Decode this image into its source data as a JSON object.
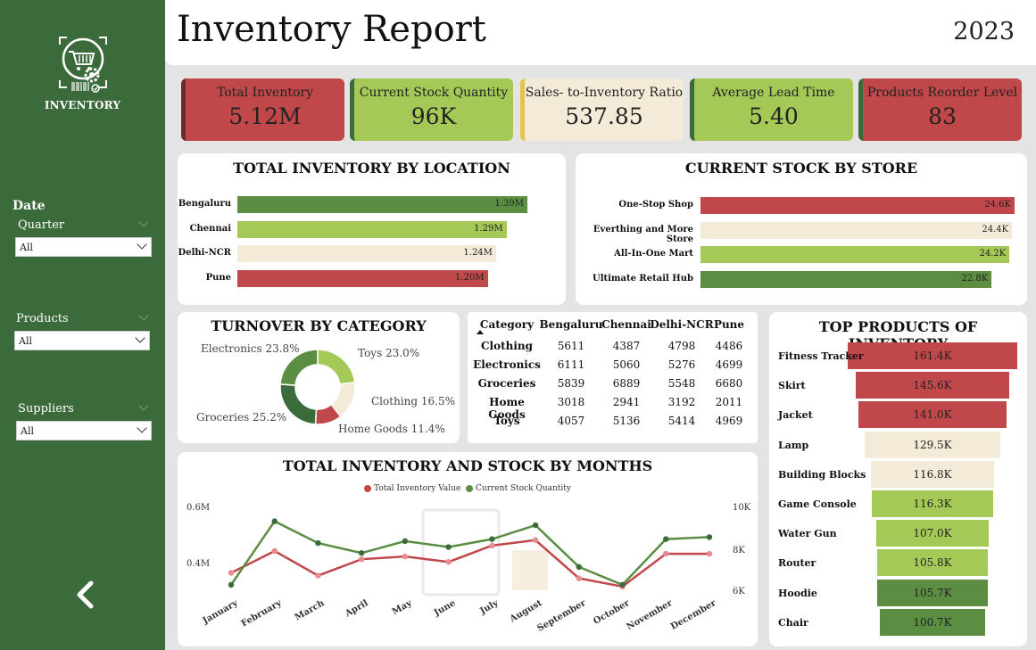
{
  "sidebar": {
    "logo_text": "INVENTORY",
    "date_label": "Date",
    "quarter_label": "Quarter",
    "quarter_value": "All",
    "products_label": "Products",
    "products_value": "All",
    "suppliers_label": "Suppliers",
    "suppliers_value": "All",
    "back_icon": "chevron-left-icon"
  },
  "header": {
    "title": "Inventory Report",
    "year": "2023"
  },
  "kpis": [
    {
      "label": "Total Inventory",
      "value": "5.12M",
      "color": "#c0474a"
    },
    {
      "label": "Current Stock Quantity",
      "value": "96K",
      "color": "#a4c957"
    },
    {
      "label": "Sales- to-Inventory Ratio",
      "value": "537.85",
      "color": "#f3ead8"
    },
    {
      "label": "Average Lead Time",
      "value": "5.40",
      "color": "#a4c957"
    },
    {
      "label": "Products Reorder Level",
      "value": "83",
      "color": "#c0474a"
    }
  ],
  "location_chart": {
    "title": "TOTAL INVENTORY BY LOCATION",
    "rows": [
      {
        "label": "Bengaluru",
        "value": 1.39,
        "display": "1.39M",
        "color": "#5b8e42"
      },
      {
        "label": "Chennai",
        "value": 1.29,
        "display": "1.29M",
        "color": "#a4c957"
      },
      {
        "label": "Delhi-NCR",
        "value": 1.24,
        "display": "1.24M",
        "color": "#f3ead8"
      },
      {
        "label": "Pune",
        "value": 1.2,
        "display": "1.20M",
        "color": "#c0474a"
      }
    ]
  },
  "store_chart": {
    "title": "CURRENT STOCK BY STORE",
    "rows": [
      {
        "label": "One-Stop Shop",
        "value": 24.6,
        "display": "24.6K",
        "color": "#c0474a"
      },
      {
        "label": "Everthing and More Store",
        "value": 24.4,
        "display": "24.4K",
        "color": "#f3ead8"
      },
      {
        "label": "All-In-One Mart",
        "value": 24.2,
        "display": "24.2K",
        "color": "#a4c957"
      },
      {
        "label": "Ultimate Retail Hub",
        "value": 22.8,
        "display": "22.8K",
        "color": "#5b8e42"
      }
    ]
  },
  "turnover": {
    "title": "TURNOVER BY CATEGORY",
    "labels": [
      {
        "text": "Electronics 23.8%"
      },
      {
        "text": "Toys 23.0%"
      },
      {
        "text": "Clothing 16.5%"
      },
      {
        "text": "Home Goods 11.4%"
      },
      {
        "text": "Groceries 25.2%"
      }
    ]
  },
  "table": {
    "headers": [
      "Category",
      "Bengaluru",
      "Chennai",
      "Delhi-NCR",
      "Pune"
    ],
    "sort_icon": "sort-up-icon",
    "rows": [
      [
        "Clothing",
        "5611",
        "4387",
        "4798",
        "4486"
      ],
      [
        "Electronics",
        "6111",
        "5060",
        "5276",
        "4699"
      ],
      [
        "Groceries",
        "5839",
        "6889",
        "5548",
        "6680"
      ],
      [
        "Home Goods",
        "3018",
        "2941",
        "3192",
        "2011"
      ],
      [
        "Toys",
        "4057",
        "5136",
        "5414",
        "4969"
      ]
    ]
  },
  "top_products": {
    "title": "TOP PRODUCTS OF INVENTORY",
    "rows": [
      {
        "label": "Fitness Tracker",
        "value": 161.4,
        "display": "161.4K",
        "color": "#c0474a"
      },
      {
        "label": "Skirt",
        "value": 145.6,
        "display": "145.6K",
        "color": "#c0474a"
      },
      {
        "label": "Jacket",
        "value": 141.0,
        "display": "141.0K",
        "color": "#c0474a"
      },
      {
        "label": "Lamp",
        "value": 129.5,
        "display": "129.5K",
        "color": "#f3ead8"
      },
      {
        "label": "Building Blocks",
        "value": 116.8,
        "display": "116.8K",
        "color": "#f3ead8"
      },
      {
        "label": "Game Console",
        "value": 116.3,
        "display": "116.3K",
        "color": "#a4c957"
      },
      {
        "label": "Water Gun",
        "value": 107.0,
        "display": "107.0K",
        "color": "#a4c957"
      },
      {
        "label": "Router",
        "value": 105.8,
        "display": "105.8K",
        "color": "#a4c957"
      },
      {
        "label": "Hoodie",
        "value": 105.7,
        "display": "105.7K",
        "color": "#5b8e42"
      },
      {
        "label": "Chair",
        "value": 100.7,
        "display": "100.7K",
        "color": "#5b8e42"
      }
    ]
  },
  "months_chart": {
    "title": "TOTAL INVENTORY AND STOCK BY MONTHS",
    "legend": [
      "Total Inventory Value",
      "Current Stock Quantity"
    ],
    "left_ticks": [
      "0.6M",
      "0.4M"
    ],
    "right_ticks": [
      "10K",
      "8K",
      "6K"
    ]
  },
  "chart_data": [
    {
      "type": "bar",
      "title": "TOTAL INVENTORY BY LOCATION",
      "categories": [
        "Bengaluru",
        "Chennai",
        "Delhi-NCR",
        "Pune"
      ],
      "values": [
        1.39,
        1.29,
        1.24,
        1.2
      ],
      "unit": "M"
    },
    {
      "type": "bar",
      "title": "CURRENT STOCK BY STORE",
      "categories": [
        "One-Stop Shop",
        "Everthing and More Store",
        "All-In-One Mart",
        "Ultimate Retail Hub"
      ],
      "values": [
        24.6,
        24.4,
        24.2,
        22.8
      ],
      "unit": "K"
    },
    {
      "type": "pie",
      "title": "TURNOVER BY CATEGORY",
      "categories": [
        "Electronics",
        "Toys",
        "Clothing",
        "Home Goods",
        "Groceries"
      ],
      "values": [
        23.8,
        23.0,
        16.5,
        11.4,
        25.2
      ],
      "colors": [
        "#5b8e42",
        "#a4c957",
        "#f3ead8",
        "#c0474a",
        "#3c6b3b"
      ]
    },
    {
      "type": "bar",
      "title": "TOP PRODUCTS OF INVENTORY",
      "categories": [
        "Fitness Tracker",
        "Skirt",
        "Jacket",
        "Lamp",
        "Building Blocks",
        "Game Console",
        "Water Gun",
        "Router",
        "Hoodie",
        "Chair"
      ],
      "values": [
        161.4,
        145.6,
        141.0,
        129.5,
        116.8,
        116.3,
        107.0,
        105.8,
        105.7,
        100.7
      ],
      "unit": "K"
    },
    {
      "type": "line",
      "title": "TOTAL INVENTORY AND STOCK BY MONTHS",
      "categories": [
        "January",
        "February",
        "March",
        "April",
        "May",
        "June",
        "July",
        "August",
        "September",
        "October",
        "November",
        "December"
      ],
      "series": [
        {
          "name": "Total Inventory Value",
          "axis": "left",
          "color": "#c0474a",
          "values": [
            0.38,
            0.46,
            0.37,
            0.43,
            0.44,
            0.42,
            0.48,
            0.5,
            0.36,
            0.33,
            0.45,
            0.45
          ]
        },
        {
          "name": "Current Stock Quantity",
          "axis": "right",
          "color": "#5b8e42",
          "values": [
            6.3,
            9.5,
            8.4,
            7.9,
            8.5,
            8.2,
            8.6,
            9.3,
            7.2,
            6.3,
            8.6,
            8.7
          ]
        }
      ],
      "ylim_left": [
        0.3,
        0.62
      ],
      "ylim_right": [
        5.8,
        10.2
      ],
      "left_ticks": [
        "0.6M",
        "0.4M"
      ],
      "right_ticks": [
        "10K",
        "8K",
        "6K"
      ]
    }
  ]
}
